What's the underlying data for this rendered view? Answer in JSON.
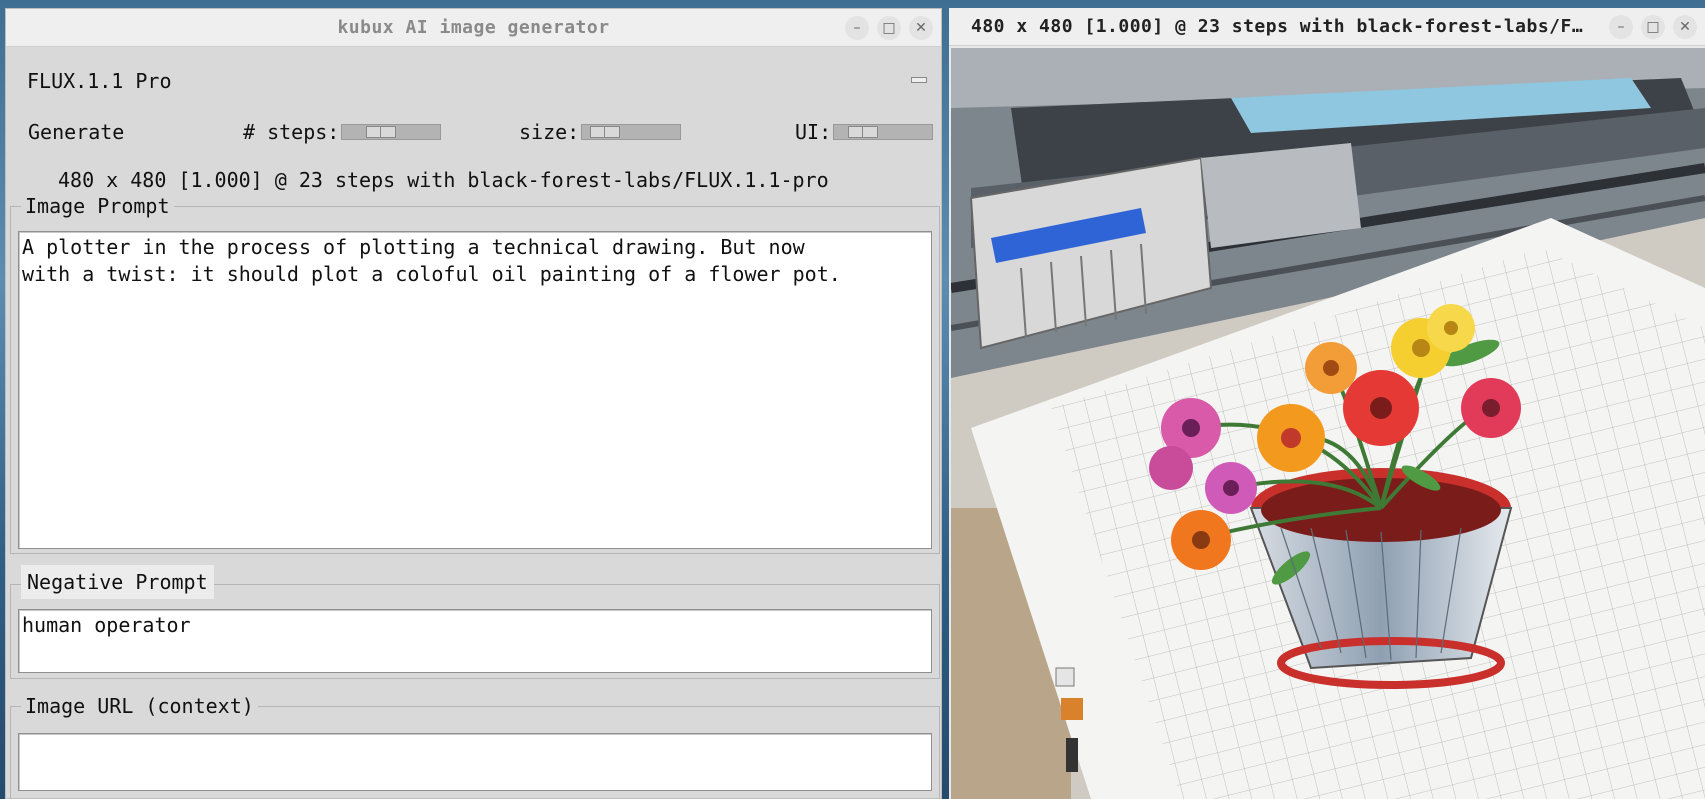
{
  "main_window": {
    "title": "kubux AI image generator",
    "model_name": "FLUX.1.1 Pro",
    "generate_label": "Generate",
    "steps_label": "# steps:",
    "size_label": "size:",
    "ui_label": "UI:",
    "status": "480 x 480 [1.000] @ 23 steps with black-forest-labs/FLUX.1.1-pro",
    "image_prompt": {
      "legend": "Image Prompt",
      "value": "A plotter in the process of plotting a technical drawing. But now\nwith a twist: it should plot a coloful oil painting of a flower pot."
    },
    "negative_prompt": {
      "legend": "Negative Prompt",
      "value": "human operator"
    },
    "image_url": {
      "legend": "Image URL (context)",
      "value": ""
    },
    "window_controls": {
      "minimize": "–",
      "maximize": "□",
      "close": "✕"
    }
  },
  "image_window": {
    "title": "480 x 480 [1.000] @ 23 steps with black-forest-labs/F…",
    "window_controls": {
      "minimize": "–",
      "maximize": "□",
      "close": "✕"
    }
  },
  "colors": {
    "window_bg": "#d9d9d9",
    "titlebar_bg": "#efefef",
    "input_bg": "#ffffff",
    "desktop_bg": "#3f6e93"
  }
}
